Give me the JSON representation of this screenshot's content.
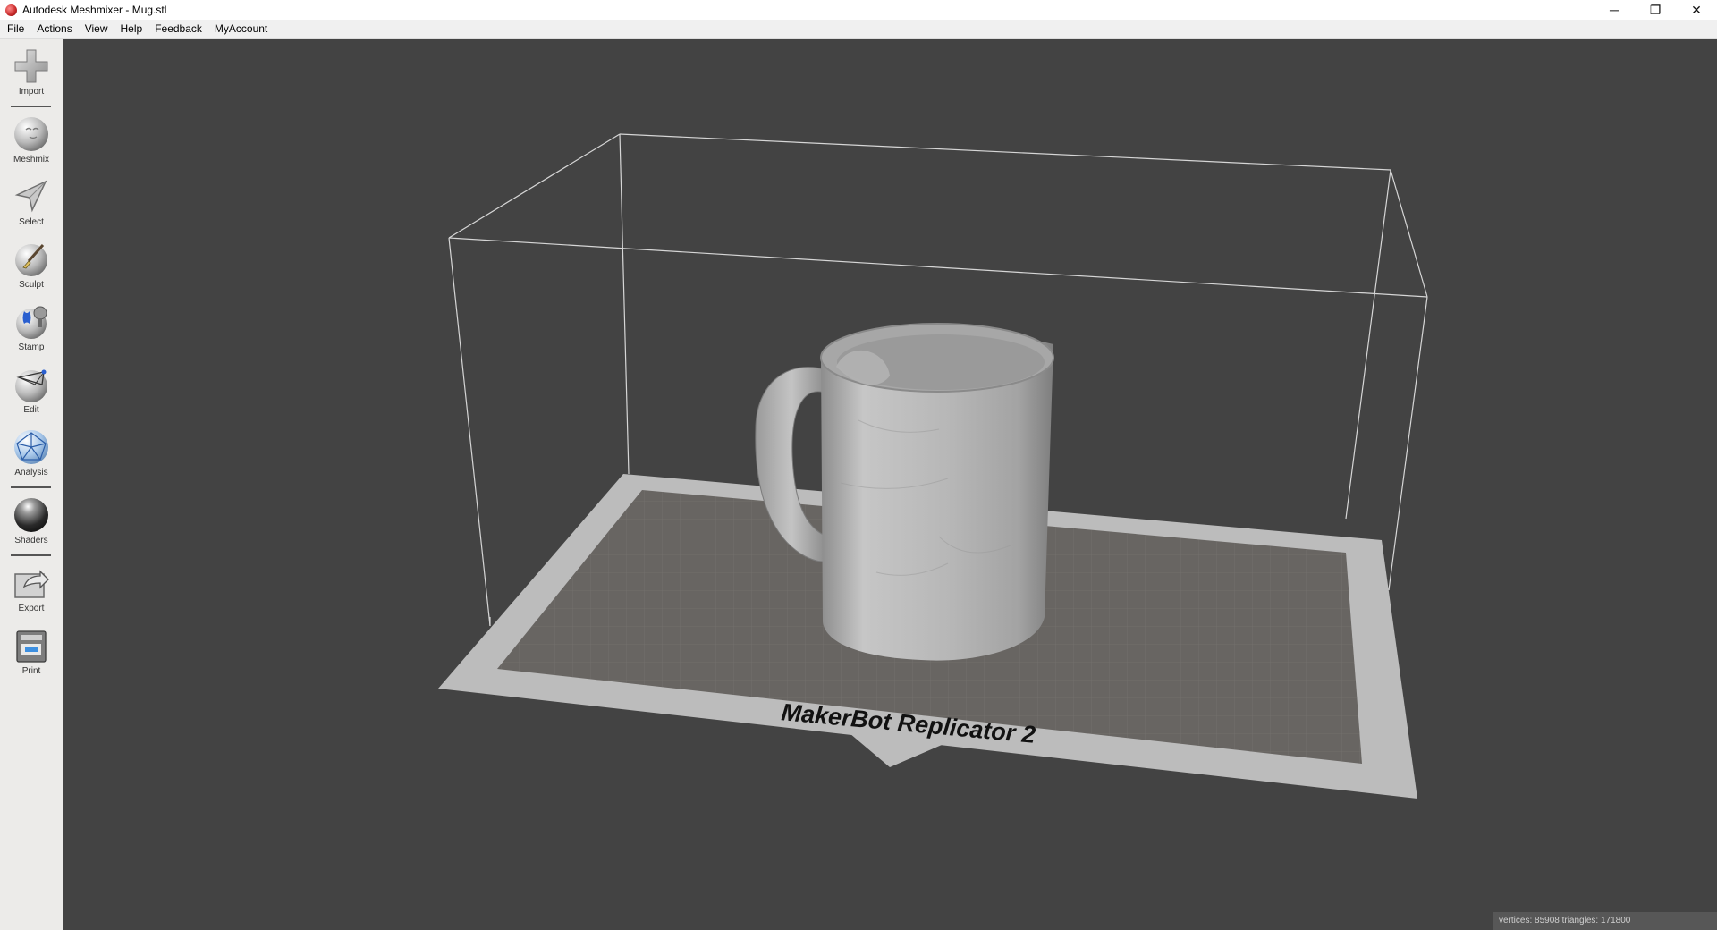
{
  "window": {
    "title": "Autodesk Meshmixer - Mug.stl",
    "controls": {
      "minimize": "─",
      "restore": "❐",
      "close": "✕"
    }
  },
  "menu": [
    "File",
    "Actions",
    "View",
    "Help",
    "Feedback",
    "MyAccount"
  ],
  "tools": [
    {
      "label": "Import",
      "icon": "plus-icon"
    },
    {
      "label": "Meshmix",
      "icon": "meshmix-sphere-icon"
    },
    {
      "label": "Select",
      "icon": "select-arrow-icon"
    },
    {
      "label": "Sculpt",
      "icon": "sculpt-brush-icon"
    },
    {
      "label": "Stamp",
      "icon": "stamp-icon"
    },
    {
      "label": "Edit",
      "icon": "edit-sphere-icon"
    },
    {
      "label": "Analysis",
      "icon": "analysis-icon"
    },
    {
      "label": "Shaders",
      "icon": "shader-ball-icon"
    },
    {
      "label": "Export",
      "icon": "export-icon"
    },
    {
      "label": "Print",
      "icon": "printer-icon"
    }
  ],
  "viewport": {
    "printer_label": "MakerBot Replicator 2",
    "status": "vertices: 85908  triangles: 171800"
  },
  "colors": {
    "viewport_bg": "#434343",
    "bed_frame": "#bcbcbc",
    "bed_surface": "#686562",
    "mug": "#b4b4b4"
  }
}
